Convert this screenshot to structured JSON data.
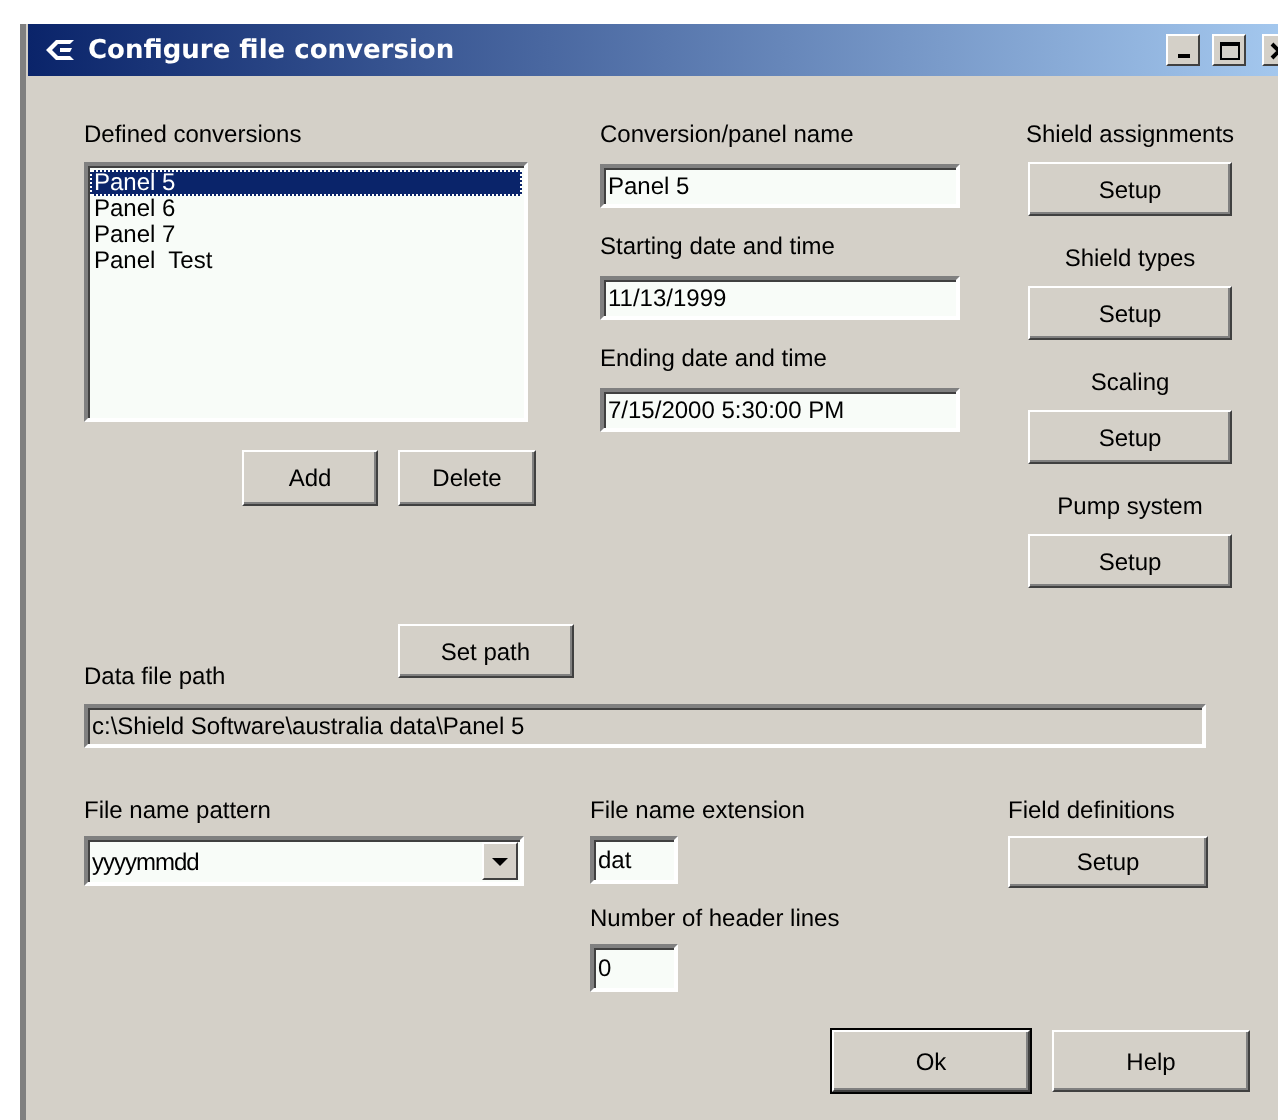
{
  "window": {
    "title": "Configure file conversion"
  },
  "conversions": {
    "label": "Defined conversions",
    "items": [
      {
        "label": "Panel 5",
        "selected": true
      },
      {
        "label": "Panel 6",
        "selected": false
      },
      {
        "label": "Panel 7",
        "selected": false
      },
      {
        "label": "Panel  Test",
        "selected": false
      }
    ],
    "buttons": [
      "Add",
      "Delete"
    ]
  },
  "fields": [
    {
      "label": "Conversion/panel name",
      "value": "Panel 5"
    },
    {
      "label": "Starting date and time",
      "value": "11/13/1999"
    },
    {
      "label": "Ending date and time",
      "value": "7/15/2000 5:30:00 PM"
    }
  ],
  "setup_groups": [
    {
      "label": "Shield assignments",
      "button": "Setup"
    },
    {
      "label": "Shield types",
      "button": "Setup"
    },
    {
      "label": "Scaling",
      "button": "Setup"
    },
    {
      "label": "Pump system",
      "button": "Setup"
    }
  ],
  "data_path": {
    "label": "Data file path",
    "button": "Set path",
    "value": "c:\\Shield Software\\australia data\\Panel 5",
    "disabled": true
  },
  "file_pattern": {
    "label": "File name pattern",
    "value": "yyyymmdd"
  },
  "extension": {
    "label": "File name extension",
    "value": "dat"
  },
  "header_lines": {
    "label": "Number of header lines",
    "value": "0"
  },
  "field_definitions": {
    "label": "Field definitions",
    "button": "Setup"
  },
  "buttons": [
    {
      "label": "Ok",
      "default": true
    },
    {
      "label": "Help",
      "default": false
    }
  ]
}
